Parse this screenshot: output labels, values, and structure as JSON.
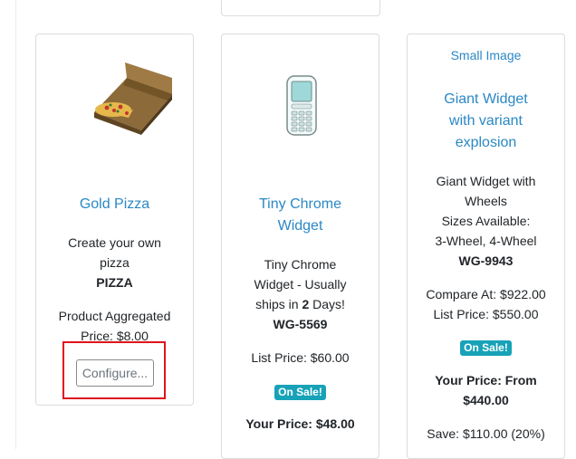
{
  "colors": {
    "link": "#2a88c5",
    "badge": "#17a2b8",
    "highlight": "#e0131b"
  },
  "products": [
    {
      "image_icon": "pizza-box-icon",
      "name": "Gold Pizza",
      "description_lines": [
        "Create your own",
        "pizza"
      ],
      "sku": "PIZZA",
      "aggregated_lines": [
        "Product Aggregated",
        "Price: $8.00"
      ],
      "configure_label": "Configure..."
    },
    {
      "image_icon": "phone-icon",
      "name_lines": [
        "Tiny Chrome",
        "Widget"
      ],
      "description_lines": [
        "Tiny Chrome",
        "Widget - Usually"
      ],
      "ships_prefix": "ships in ",
      "ships_days": "2",
      "ships_suffix": " Days!",
      "sku": "WG-5569",
      "list_price": "List Price: $60.00",
      "badge": "On Sale!",
      "your_price": "Your Price: $48.00"
    },
    {
      "image_link": "Small Image",
      "name_lines": [
        "Giant Widget",
        "with variant",
        "explosion"
      ],
      "description_lines": [
        "Giant Widget with",
        "Wheels",
        "Sizes Available:",
        "3-Wheel, 4-Wheel"
      ],
      "sku": "WG-9943",
      "compare_at": "Compare At: $922.00",
      "list_price": "List Price: $550.00",
      "badge": "On Sale!",
      "your_price_lines": [
        "Your Price: From",
        "$440.00"
      ],
      "save": "Save: $110.00 (20%)"
    }
  ]
}
